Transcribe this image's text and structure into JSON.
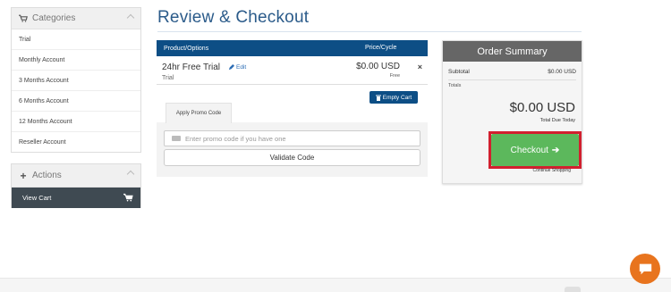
{
  "sidebar": {
    "categories": {
      "title": "Categories",
      "icon": "cart-icon",
      "items": [
        {
          "label": "Trial"
        },
        {
          "label": "Monthly Account"
        },
        {
          "label": "3 Months Account"
        },
        {
          "label": "6 Months Account"
        },
        {
          "label": "12 Months Account"
        },
        {
          "label": "Reseller Account"
        }
      ]
    },
    "actions": {
      "title": "Actions",
      "icon": "plus-icon",
      "items": [
        {
          "label": "View Cart",
          "icon": "cart-icon"
        }
      ]
    }
  },
  "main": {
    "title": "Review & Checkout",
    "table": {
      "col_product": "Product/Options",
      "col_price": "Price/Cycle"
    },
    "item": {
      "name": "24hr Free Trial",
      "edit": "Edit",
      "subtitle": "Trial",
      "price": "$0.00 USD",
      "cycle": "Free",
      "remove": "×"
    },
    "empty_cart": "Empty Cart",
    "promo": {
      "tab": "Apply Promo Code",
      "placeholder": "Enter promo code if you have one",
      "validate": "Validate Code"
    }
  },
  "summary": {
    "title": "Order Summary",
    "subtotal_label": "Subtotal",
    "subtotal_value": "$0.00 USD",
    "totals_label": "Totals",
    "total_amount": "$0.00 USD",
    "total_due": "Total Due Today",
    "checkout": "Checkout",
    "continue": "Continue Shopping"
  },
  "colors": {
    "accent": "#0d4e85",
    "title": "#2b5b8a",
    "checkout": "#5cb85c",
    "highlight": "#d2202f",
    "chat": "#e8741e"
  }
}
